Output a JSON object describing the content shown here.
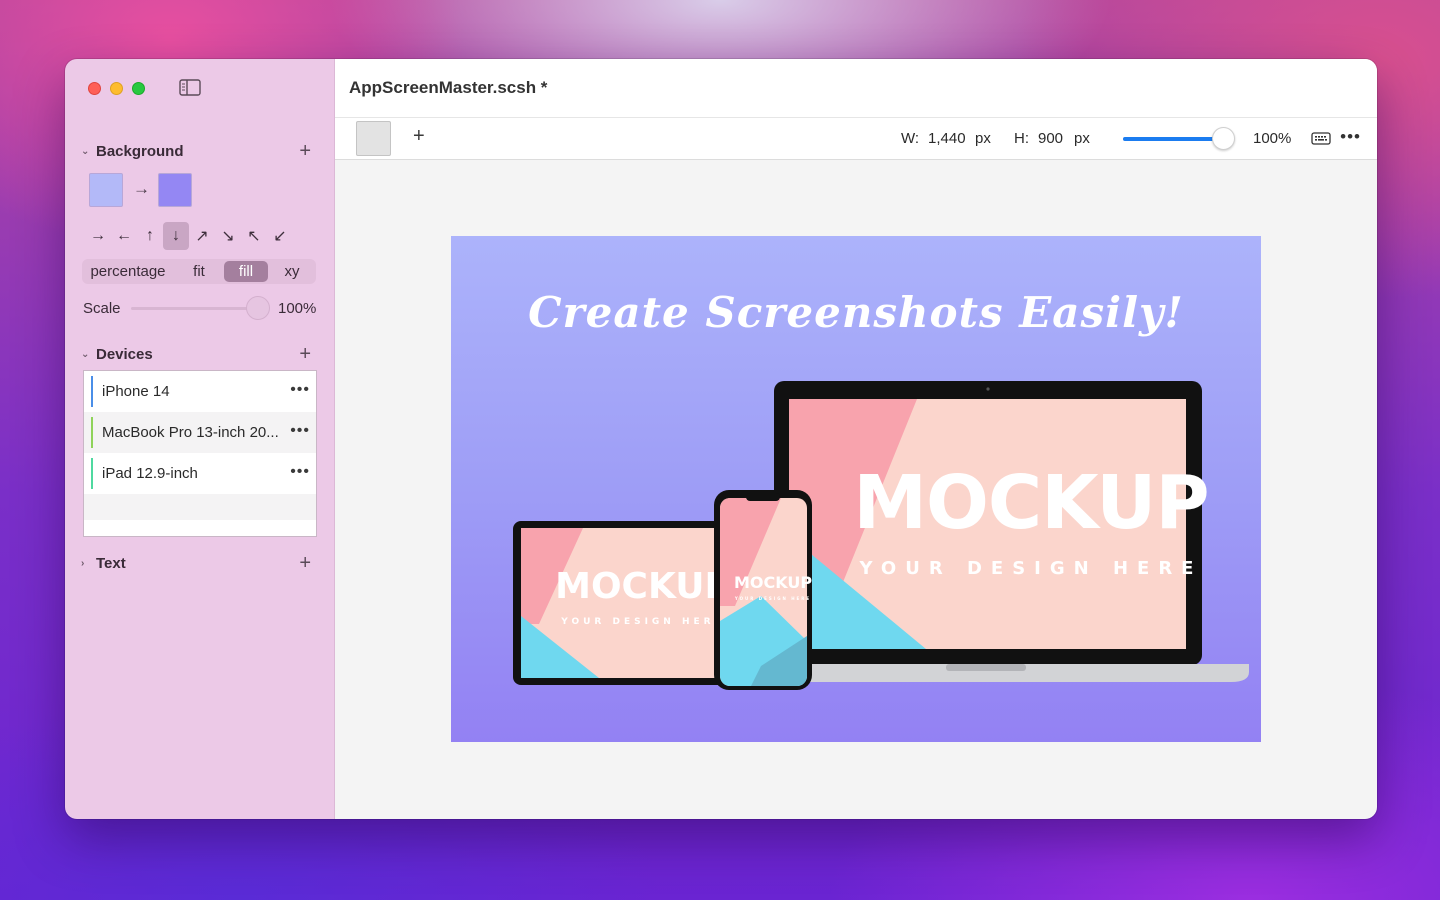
{
  "window": {
    "document_title": "AppScreenMaster.scsh *"
  },
  "sidebar": {
    "background": {
      "title": "Background",
      "gradient_start": "#b3b9f8",
      "gradient_end": "#9487f3",
      "directions": [
        "→",
        "←",
        "↑",
        "↓",
        "↗",
        "↘",
        "↖",
        "↙"
      ],
      "active_direction_index": 3,
      "modes": [
        "percentage",
        "fit",
        "fill",
        "xy"
      ],
      "active_mode": "fill",
      "scale_label": "Scale",
      "scale_value": "100%"
    },
    "devices": {
      "title": "Devices",
      "items": [
        {
          "name": "iPhone 14",
          "color": "#4a8ee8"
        },
        {
          "name": "MacBook Pro 13-inch 20...",
          "color": "#8fd35a"
        },
        {
          "name": "iPad 12.9-inch",
          "color": "#4fd9a0"
        }
      ]
    },
    "text": {
      "title": "Text"
    }
  },
  "toolbar": {
    "width_label": "W:",
    "width_value": "1,440",
    "width_unit": "px",
    "height_label": "H:",
    "height_value": "900",
    "height_unit": "px",
    "zoom_value": "100%",
    "zoom_fraction": 0.92
  },
  "canvas": {
    "headline": "Create Screenshots Easily!",
    "mockup_title": "MOCKUP",
    "mockup_subtitle": "YOUR DESIGN HERE"
  }
}
